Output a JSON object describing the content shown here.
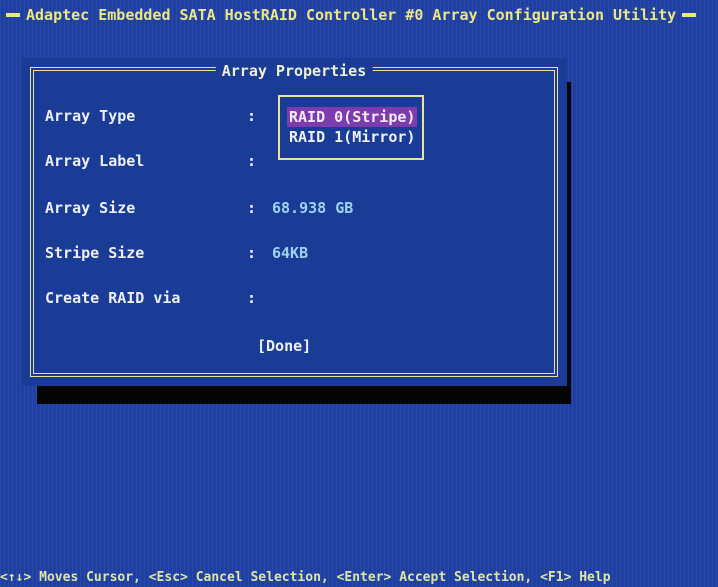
{
  "window": {
    "title": "Adaptec Embedded SATA HostRAID Controller #0 Array Configuration Utility"
  },
  "dialog": {
    "title": "Array Properties",
    "fields": [
      {
        "label": "Array Type",
        "colon": ":",
        "value": ""
      },
      {
        "label": "Array Label",
        "colon": ":",
        "value": ""
      },
      {
        "label": "Array Size",
        "colon": ":",
        "value": "68.938 GB"
      },
      {
        "label": "Stripe Size",
        "colon": ":",
        "value": "64KB"
      },
      {
        "label": "Create RAID via",
        "colon": ":",
        "value": ""
      }
    ],
    "done_label": "[Done]"
  },
  "array_type_popup": {
    "options": [
      "RAID 0(Stripe)",
      "RAID 1(Mirror)"
    ],
    "selected": "RAID 0(Stripe)"
  },
  "status_bar": {
    "items": [
      {
        "key": "<↑↓>",
        "desc": "Moves Cursor,"
      },
      {
        "key": "<Esc>",
        "desc": "Cancel Selection,"
      },
      {
        "key": "<Enter>",
        "desc": "Accept Selection,"
      },
      {
        "key": "<F1>",
        "desc": "Help"
      }
    ]
  },
  "colors": {
    "screen_background": "#1f3fa2",
    "frame": "#e6e59a",
    "highlight": "#7c3cad",
    "value_text": "#9fd2f0"
  }
}
